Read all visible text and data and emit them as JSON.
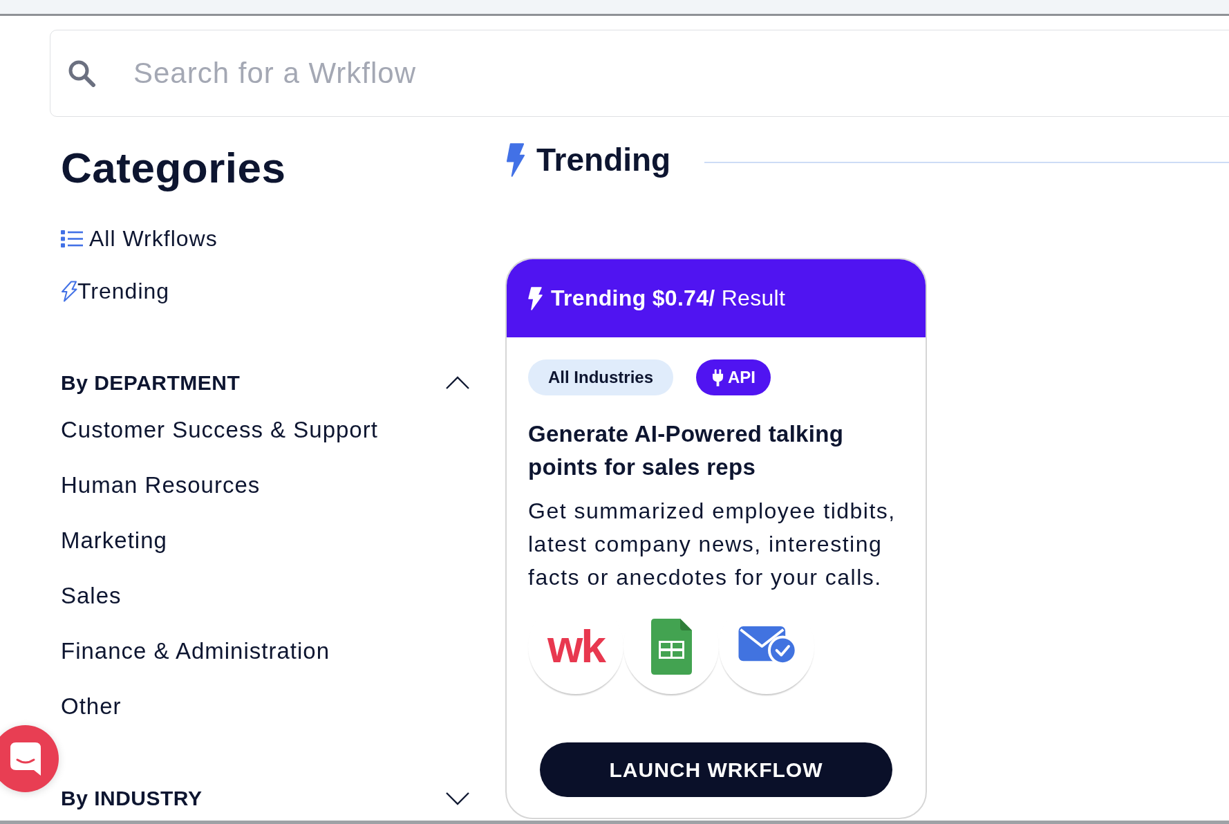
{
  "search": {
    "placeholder": "Search for a Wrkflow"
  },
  "sidebar": {
    "title": "Categories",
    "links": [
      {
        "kind": "list",
        "label": "All Wrkflows"
      },
      {
        "kind": "bolt",
        "label": "Trending"
      }
    ],
    "groups": [
      {
        "label": "By DEPARTMENT",
        "expanded": true,
        "items": [
          "Customer Success & Support",
          "Human Resources",
          "Marketing",
          "Sales",
          "Finance & Administration",
          "Other"
        ]
      },
      {
        "label": "By INDUSTRY",
        "expanded": false
      }
    ]
  },
  "section": {
    "title": "Trending"
  },
  "cards": [
    {
      "header": "**Trending $0.74/** Result",
      "tags": [
        {
          "kind": "plain",
          "label": "All Industries"
        },
        {
          "kind": "api",
          "label": "API"
        }
      ],
      "title": "Generate AI-Powered talking points for sales reps",
      "description": "Get summarized employee tidbits, latest company news, interesting facts or anecdotes for your calls.",
      "integrations": [
        {
          "kind": "wordmark",
          "text": "wk"
        },
        {
          "kind": "spreadsheet"
        },
        {
          "kind": "email"
        }
      ],
      "button": "LAUNCH WRKFLOW"
    }
  ]
}
